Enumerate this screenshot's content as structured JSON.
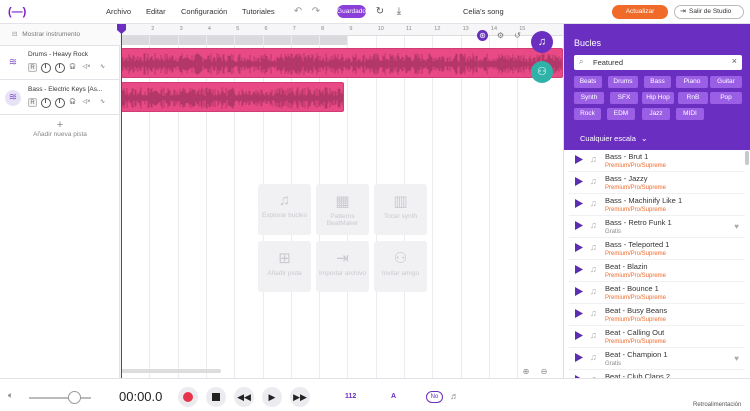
{
  "topbar": {
    "logo": "(—)",
    "menu": [
      "Archivo",
      "Editar",
      "Configuración",
      "Tutoriales"
    ],
    "saved_label": "Guardado",
    "song_title": "Celia's song",
    "update_label": "Actualizar",
    "exit_label": "Salir de Studio"
  },
  "tracks_panel": {
    "show_instrument": "Mostrar instrumento",
    "tracks": [
      {
        "name": "Drums - Heavy Rock",
        "r": "R",
        "s": "S"
      },
      {
        "name": "Bass - Electric Keys [As...",
        "r": "R",
        "s": "S"
      }
    ],
    "add_track": "Añadir nueva pista"
  },
  "timeline": {
    "ruler": [
      "1",
      "2",
      "3",
      "4",
      "5",
      "6",
      "7",
      "8",
      "9",
      "10",
      "11",
      "12",
      "13",
      "14",
      "15"
    ],
    "empty_actions": [
      {
        "label": "Explorar bucles",
        "icon": "music-note-icon"
      },
      {
        "label": "Patterns BeatMaker",
        "icon": "drum-pad-icon"
      },
      {
        "label": "Tocar synth",
        "icon": "piano-icon"
      },
      {
        "label": "Añadir pista",
        "icon": "add-track-icon"
      },
      {
        "label": "Importar archivo",
        "icon": "import-icon"
      },
      {
        "label": "Invitar amigo",
        "icon": "invite-icon"
      }
    ]
  },
  "loops": {
    "title": "Bucles",
    "search_value": "Featured",
    "chips": [
      "Beats",
      "Drums",
      "Bass",
      "Piano",
      "Guitar",
      "Synth",
      "SFX",
      "Hip Hop",
      "RnB",
      "Pop",
      "Rock",
      "EDM",
      "Jazz",
      "MIDI"
    ],
    "scale": "Cualquier escala",
    "items": [
      {
        "name": "Bass - Brut 1",
        "tier": "Premium/Pro/Supreme"
      },
      {
        "name": "Bass - Jazzy",
        "tier": "Premium/Pro/Supreme"
      },
      {
        "name": "Bass - Machinify Like 1",
        "tier": "Premium/Pro/Supreme"
      },
      {
        "name": "Bass - Retro Funk 1",
        "tier": "Gratis"
      },
      {
        "name": "Bass - Teleported 1",
        "tier": "Premium/Pro/Supreme"
      },
      {
        "name": "Beat - Blazin",
        "tier": "Premium/Pro/Supreme"
      },
      {
        "name": "Beat - Bounce 1",
        "tier": "Premium/Pro/Supreme"
      },
      {
        "name": "Beat - Busy Beans",
        "tier": "Premium/Pro/Supreme"
      },
      {
        "name": "Beat - Calling Out",
        "tier": "Premium/Pro/Supreme"
      },
      {
        "name": "Beat - Champion 1",
        "tier": "Gratis"
      },
      {
        "name": "Beat - Club Claps 2",
        "tier": ""
      }
    ]
  },
  "transport": {
    "time": "00:00.0",
    "bpm": "112",
    "key": "A",
    "metronome": "No",
    "feedback": "Retroalimentación"
  },
  "colors": {
    "accent": "#6a2fc0",
    "clip": "#e94a85",
    "update": "#f06a2a",
    "collab": "#2fb3a8"
  }
}
